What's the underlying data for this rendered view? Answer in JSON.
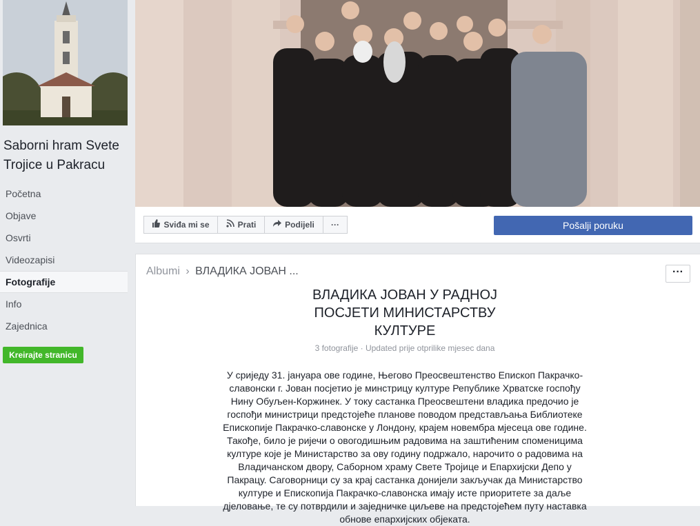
{
  "sidebar": {
    "page_name": "Saborni hram Svete Trojice u Pakracu",
    "items": [
      {
        "label": "Početna"
      },
      {
        "label": "Objave"
      },
      {
        "label": "Osvrti"
      },
      {
        "label": "Videozapisi"
      },
      {
        "label": "Fotografije",
        "active": true
      },
      {
        "label": "Info"
      },
      {
        "label": "Zajednica"
      }
    ],
    "create_page": "Kreirajte stranicu"
  },
  "actions": {
    "like": "Sviđa mi se",
    "follow": "Prati",
    "share": "Podijeli",
    "more": "···",
    "send_message": "Pošalji poruku"
  },
  "album": {
    "breadcrumb_root": "Albumi",
    "breadcrumb_separator": "›",
    "breadcrumb_current": "ВЛАДИКА ЈОВАН ...",
    "more": "···",
    "title": "ВЛАДИКА ЈОВАН У РАДНОЈ ПОСЈЕТИ МИНИСТАРСТВУ КУЛТУРЕ",
    "meta": "3 fotografije · Updated prije otprilike mjesec dana",
    "description": "У сриједу 31. јануара ове године, Његово Преосвештенство Епископ Пакрачко-славонски г. Јован посјетио је минстрицу културе Републике Хрватске госпођу Нину Обуљен-Коржинек. У току састанка Преосвештени владика предочио је госпођи министрици предстојеће планове поводом представљања Библиотеке Епископије Пакрачко-славонске у Лондону, крајем новембра мјесеца ове године. Такође, било је ријечи о овогодишњим радовима на заштићеним споменицима културе које је Министарство за ову годину подржало, нарочито о радовима на Владичанском двору, Саборном храму Свете Тројице и Епархијски Депо у Пакрацу. Саговорници су за крај састанка донијели закључак да Министарство културе и Епископија Пакрачко-славонска имају исте приоритете за даље дјеловање, те су потврдили и заједничке циљеве на предстојећем путу наставка обнове епархијских објеката."
  },
  "colors": {
    "facebook_blue": "#4267b2",
    "create_green": "#42b72a",
    "sidebar_bg": "#e9ebee"
  }
}
